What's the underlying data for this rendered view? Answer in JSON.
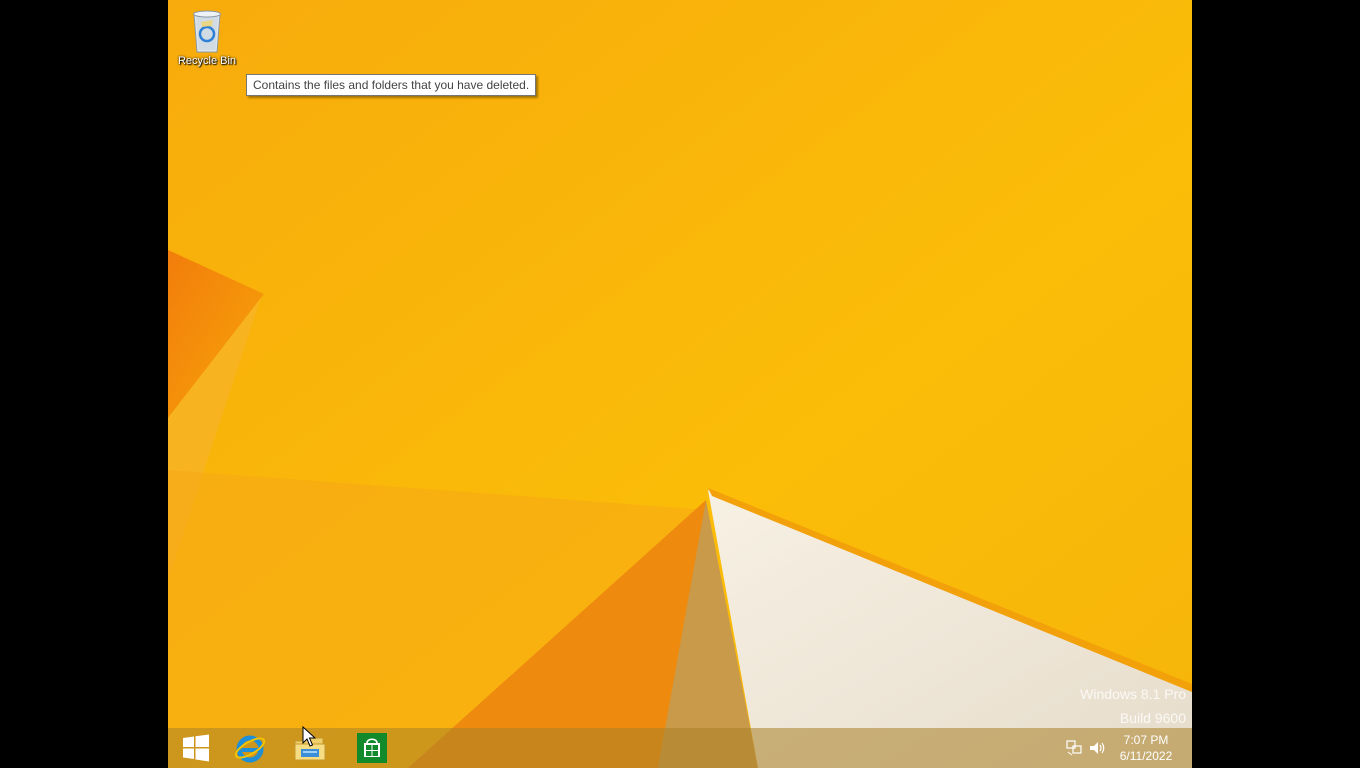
{
  "desktop": {
    "icons": [
      {
        "label": "Recycle Bin",
        "icon": "recycle-bin-icon"
      }
    ],
    "tooltip": "Contains the files and folders that you have deleted."
  },
  "watermark": {
    "line1": "Windows 8.1 Pro",
    "line2": "Build 9600"
  },
  "taskbar": {
    "pinned": [
      {
        "name": "start-button",
        "icon": "windows-logo-icon"
      },
      {
        "name": "internet-explorer",
        "icon": "internet-explorer-icon"
      },
      {
        "name": "file-explorer",
        "icon": "file-explorer-icon"
      },
      {
        "name": "store",
        "icon": "store-icon"
      }
    ],
    "tray": [
      {
        "icon": "network-icon"
      },
      {
        "icon": "volume-icon"
      }
    ],
    "clock": {
      "time": "7:07 PM",
      "date": "6/11/2022"
    }
  },
  "colors": {
    "wallpaper": "#f9b40a",
    "taskbar": "#aa8228",
    "store": "#128a2c",
    "ie": "#1c8fd8"
  }
}
